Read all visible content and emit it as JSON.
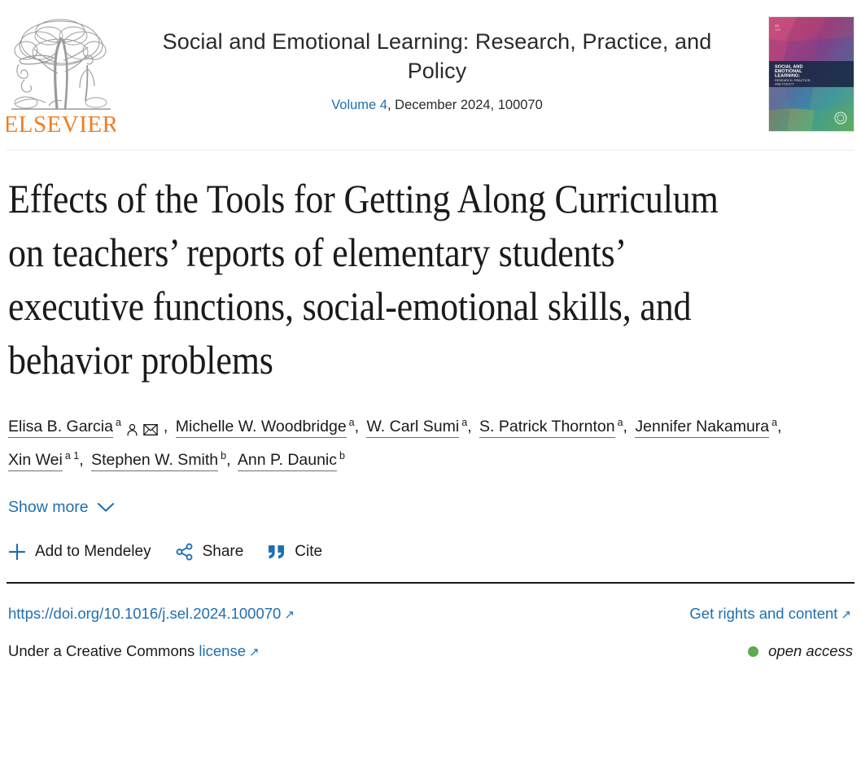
{
  "publisher": {
    "name": "ELSEVIER",
    "logo_icon": "elsevier-tree-logo",
    "wordmark_color": "#ef7d22"
  },
  "journal": {
    "title": "Social and Emotional Learning: Research, Practice, and Policy",
    "volume_link": "Volume 4",
    "issue_meta": ", December 2024, 100070",
    "cover_alt": "SOCIAL AND EMOTIONAL LEARNING: RESEARCH, PRACTICE, AND POLICY",
    "cover_band_line1": "SOCIAL AND",
    "cover_band_line2": "EMOTIONAL",
    "cover_band_line3": "LEARNING:",
    "cover_band_line4": "RESEARCH, PRACTICE,",
    "cover_band_line5": "AND POLICY",
    "link_color": "#1f6fb2"
  },
  "article": {
    "title": "Effects of the Tools for Getting Along Curriculum on teachers’ reports of elementary students’ executive functions, social-emotional skills, and behavior problems",
    "authors": [
      {
        "name": "Elisa B. Garcia",
        "sup": "a",
        "has_person_icon": true,
        "has_envelope_icon": true,
        "trailing": ","
      },
      {
        "name": "Michelle W. Woodbridge",
        "sup": "a",
        "trailing": ","
      },
      {
        "name": "W. Carl Sumi",
        "sup": "a",
        "trailing": ","
      },
      {
        "name": "S. Patrick Thornton",
        "sup": "a",
        "trailing": ","
      },
      {
        "name": "Jennifer Nakamura",
        "sup": "a",
        "trailing": ","
      },
      {
        "name": "Xin Wei",
        "sup": "a 1",
        "trailing": ","
      },
      {
        "name": "Stephen W. Smith",
        "sup": "b",
        "trailing": ","
      },
      {
        "name": "Ann P. Daunic",
        "sup": "b",
        "trailing": ""
      }
    ],
    "show_more_label": "Show more",
    "show_more_icon": "chevron-down-icon"
  },
  "actions": [
    {
      "label": "Add to Mendeley",
      "icon": "plus-icon",
      "name": "add-to-mendeley-button"
    },
    {
      "label": "Share",
      "icon": "share-nodes-icon",
      "name": "share-button"
    },
    {
      "label": "Cite",
      "icon": "quote-icon",
      "name": "cite-button"
    }
  ],
  "doi_row": {
    "doi_link": "https://doi.org/10.1016/j.sel.2024.100070",
    "doi_icon": "external-link-icon",
    "rights_label": "Get rights and content",
    "rights_icon": "external-link-icon"
  },
  "license_row": {
    "prefix": "Under a Creative Commons",
    "license_link": "license",
    "license_icon": "external-link-icon",
    "open_access_label": "open access",
    "open_access_dot_color": "#5eab4d"
  }
}
